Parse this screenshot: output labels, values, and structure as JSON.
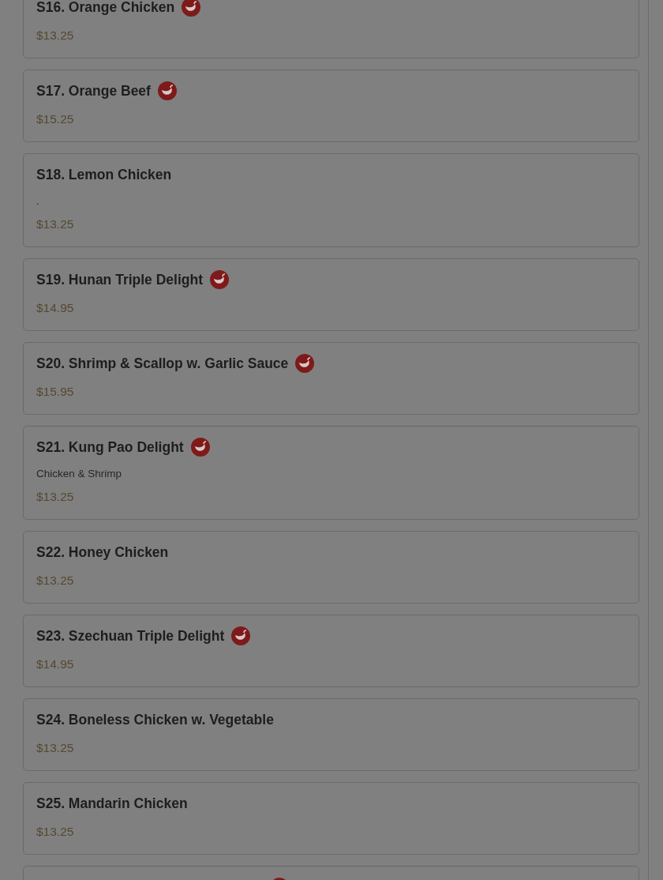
{
  "menu_items": [
    {
      "name": "S16. Orange Chicken",
      "spicy": true,
      "price": "$13.25"
    },
    {
      "name": "S17. Orange Beef",
      "spicy": true,
      "price": "$15.25"
    },
    {
      "name": "S18. Lemon Chicken",
      "spicy": false,
      "description": ".",
      "price": "$13.25"
    },
    {
      "name": "S19. Hunan Triple Delight",
      "spicy": true,
      "price": "$14.95"
    },
    {
      "name": "S20. Shrimp & Scallop w. Garlic Sauce",
      "spicy": true,
      "price": "$15.95"
    },
    {
      "name": "S21. Kung Pao Delight",
      "spicy": true,
      "description": "Chicken & Shrimp",
      "price": "$13.25"
    },
    {
      "name": "S22. Honey Chicken",
      "spicy": false,
      "price": "$13.25"
    },
    {
      "name": "S23. Szechuan Triple Delight",
      "spicy": true,
      "price": "$14.95"
    },
    {
      "name": "S24. Boneless Chicken w. Vegetable",
      "spicy": false,
      "price": "$13.25"
    },
    {
      "name": "S25. Mandarin Chicken",
      "spicy": false,
      "price": "$13.25"
    },
    {
      "spicy": true
    }
  ]
}
